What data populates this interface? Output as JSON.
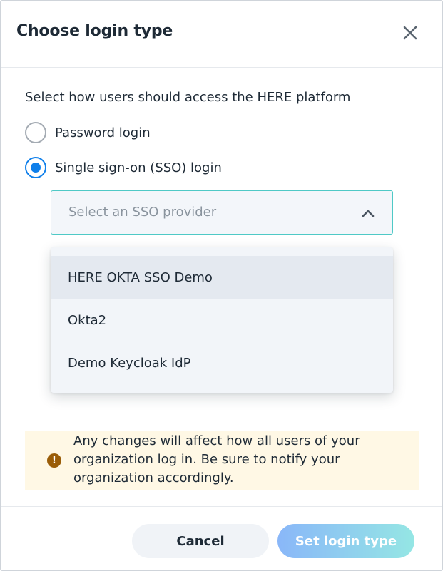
{
  "dialog": {
    "title": "Choose login type",
    "close_icon": "close-icon"
  },
  "intro": "Select how users should access the HERE platform",
  "login_options": [
    {
      "label": "Password login",
      "selected": false
    },
    {
      "label": "Single sign-on (SSO) login",
      "selected": true
    }
  ],
  "sso_select": {
    "placeholder": "Select an SSO provider",
    "expanded": true,
    "chevron_icon": "chevron-up-icon",
    "options": [
      "HERE OKTA SSO Demo",
      "Okta2",
      "Demo Keycloak IdP"
    ],
    "highlighted_index": 0
  },
  "notice": {
    "icon": "exclamation-icon",
    "text": "Any changes will affect how all users of your organization log in. Be sure to notify your organization accordingly."
  },
  "footer": {
    "cancel_label": "Cancel",
    "submit_label": "Set login type"
  },
  "colors": {
    "accent_blue": "#0f7fea",
    "select_border": "#4fc9c6",
    "notice_bg": "#fff8e5",
    "notice_icon": "#9a5d08"
  }
}
